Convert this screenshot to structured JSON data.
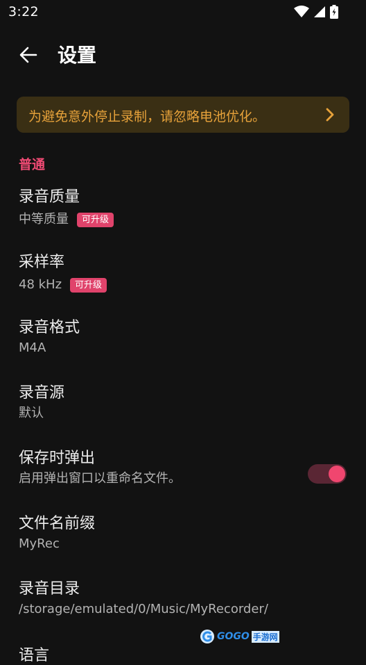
{
  "status_bar": {
    "time": "3:22"
  },
  "app_bar": {
    "title": "设置"
  },
  "banner": {
    "text": "为避免意外停止录制，请忽略电池优化。"
  },
  "section": {
    "general": "普通"
  },
  "settings": {
    "quality": {
      "title": "录音质量",
      "value": "中等质量",
      "badge": "可升级"
    },
    "sample_rate": {
      "title": "采样率",
      "value": "48 kHz",
      "badge": "可升级"
    },
    "format": {
      "title": "录音格式",
      "value": "M4A"
    },
    "source": {
      "title": "录音源",
      "value": "默认"
    },
    "popup_on_save": {
      "title": "保存时弹出",
      "description": "启用弹出窗口以重命名文件。",
      "enabled": true
    },
    "filename_prefix": {
      "title": "文件名前缀",
      "value": "MyRec"
    },
    "directory": {
      "title": "录音目录",
      "value": "/storage/emulated/0/Music/MyRecorder/"
    },
    "language": {
      "title": "语言"
    }
  },
  "watermark": {
    "text": "GOGO",
    "cn": "手游网"
  },
  "colors": {
    "background": "#121212",
    "accent": "#ee4a73",
    "banner_bg": "#3a2f14",
    "banner_text": "#e7a23a",
    "badge_bg": "#e0436b"
  }
}
